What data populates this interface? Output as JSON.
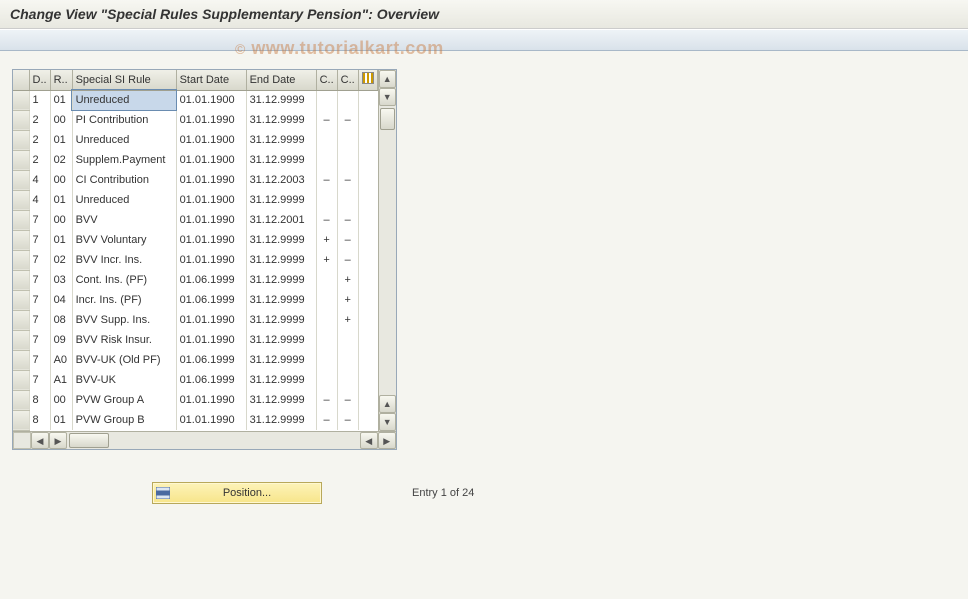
{
  "title": "Change View \"Special Rules Supplementary Pension\": Overview",
  "watermark": "www.tutorialkart.com",
  "columns": {
    "d": "D..",
    "r": "R..",
    "rule": "Special SI Rule",
    "start": "Start Date",
    "end": "End Date",
    "c1": "C..",
    "c2": "C.."
  },
  "rows": [
    {
      "d": "1",
      "r": "01",
      "rule": "Unreduced",
      "start": "01.01.1900",
      "end": "31.12.9999",
      "c1": "",
      "c2": "",
      "sel": true
    },
    {
      "d": "2",
      "r": "00",
      "rule": "PI Contribution",
      "start": "01.01.1990",
      "end": "31.12.9999",
      "c1": "–",
      "c2": "–"
    },
    {
      "d": "2",
      "r": "01",
      "rule": "Unreduced",
      "start": "01.01.1900",
      "end": "31.12.9999",
      "c1": "",
      "c2": ""
    },
    {
      "d": "2",
      "r": "02",
      "rule": "Supplem.Payment",
      "start": "01.01.1900",
      "end": "31.12.9999",
      "c1": "",
      "c2": ""
    },
    {
      "d": "4",
      "r": "00",
      "rule": "CI Contribution",
      "start": "01.01.1990",
      "end": "31.12.2003",
      "c1": "–",
      "c2": "–"
    },
    {
      "d": "4",
      "r": "01",
      "rule": "Unreduced",
      "start": "01.01.1900",
      "end": "31.12.9999",
      "c1": "",
      "c2": ""
    },
    {
      "d": "7",
      "r": "00",
      "rule": "BVV",
      "start": "01.01.1990",
      "end": "31.12.2001",
      "c1": "–",
      "c2": "–"
    },
    {
      "d": "7",
      "r": "01",
      "rule": "BVV Voluntary",
      "start": "01.01.1990",
      "end": "31.12.9999",
      "c1": "+",
      "c2": "–"
    },
    {
      "d": "7",
      "r": "02",
      "rule": "BVV Incr. Ins.",
      "start": "01.01.1990",
      "end": "31.12.9999",
      "c1": "+",
      "c2": "–"
    },
    {
      "d": "7",
      "r": "03",
      "rule": "Cont. Ins. (PF)",
      "start": "01.06.1999",
      "end": "31.12.9999",
      "c1": "",
      "c2": "+"
    },
    {
      "d": "7",
      "r": "04",
      "rule": "Incr. Ins. (PF)",
      "start": "01.06.1999",
      "end": "31.12.9999",
      "c1": "",
      "c2": "+"
    },
    {
      "d": "7",
      "r": "08",
      "rule": "BVV Supp. Ins.",
      "start": "01.01.1990",
      "end": "31.12.9999",
      "c1": "",
      "c2": "+"
    },
    {
      "d": "7",
      "r": "09",
      "rule": "BVV Risk Insur.",
      "start": "01.01.1990",
      "end": "31.12.9999",
      "c1": "",
      "c2": ""
    },
    {
      "d": "7",
      "r": "A0",
      "rule": "BVV-UK (Old PF)",
      "start": "01.06.1999",
      "end": "31.12.9999",
      "c1": "",
      "c2": ""
    },
    {
      "d": "7",
      "r": "A1",
      "rule": "BVV-UK",
      "start": "01.06.1999",
      "end": "31.12.9999",
      "c1": "",
      "c2": ""
    },
    {
      "d": "8",
      "r": "00",
      "rule": "PVW Group A",
      "start": "01.01.1990",
      "end": "31.12.9999",
      "c1": "–",
      "c2": "–"
    },
    {
      "d": "8",
      "r": "01",
      "rule": "PVW Group B",
      "start": "01.01.1990",
      "end": "31.12.9999",
      "c1": "–",
      "c2": "–"
    }
  ],
  "footer": {
    "position_label": "Position...",
    "entry_text": "Entry 1 of 24"
  }
}
